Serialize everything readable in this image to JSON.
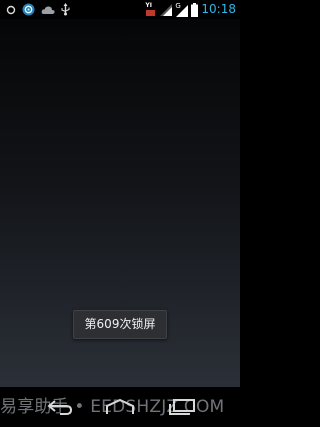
{
  "status_bar": {
    "time": "10:18",
    "icons_left": [
      "circle-icon",
      "sync-icon",
      "cloud-icon",
      "usb-icon"
    ],
    "icons_right": [
      "signal-icon",
      "wifi-icon",
      "cell-signal-icon",
      "battery-icon"
    ],
    "signal_label": "YI",
    "network_label": "G"
  },
  "toast": {
    "text": "第609次锁屏"
  },
  "nav_bar": {
    "buttons": [
      "back-icon",
      "home-icon",
      "recent-apps-icon"
    ]
  },
  "watermark": {
    "text": "易享助手 • EEDSHZJZ.COM"
  },
  "colors": {
    "clock": "#33b5e5",
    "background_top": "#050607",
    "background_bottom": "#2b3038",
    "toast_bg": "#2d2f33"
  }
}
